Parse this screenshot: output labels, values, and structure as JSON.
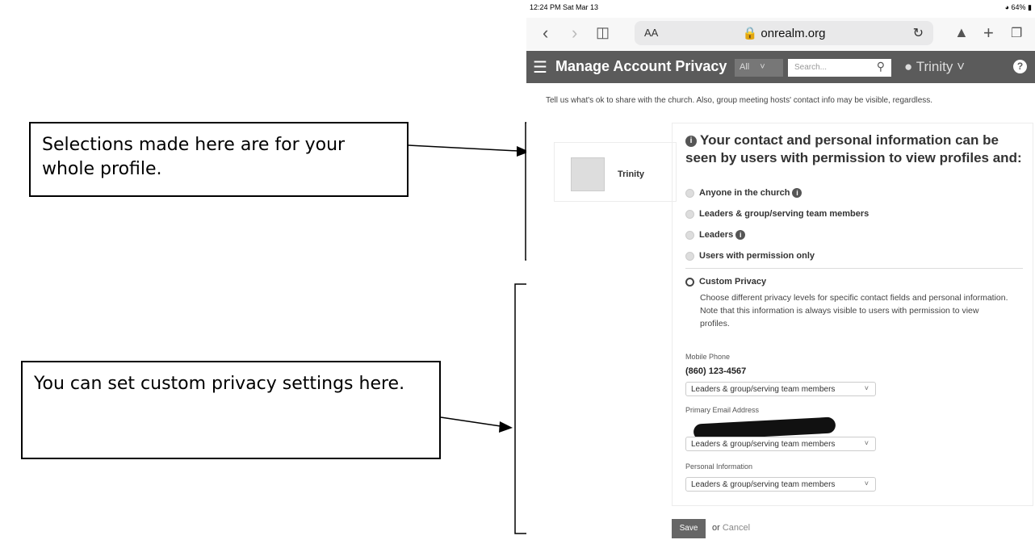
{
  "callouts": {
    "profile": "Selections made here are for your whole profile.",
    "custom": "You can set custom privacy settings here."
  },
  "status_bar": {
    "time": "12:24 PM  Sat Mar 13",
    "battery": "64%"
  },
  "browser": {
    "text_size": "AA",
    "host": "onrealm.org"
  },
  "header": {
    "title": "Manage Account Privacy",
    "filter": "All",
    "search_placeholder": "Search...",
    "user": "Trinity"
  },
  "intro": "Tell us what's ok to share with the church. Also, group meeting hosts' contact info may be visible, regardless.",
  "profile": {
    "name": "Trinity"
  },
  "privacy": {
    "heading": "Your contact and personal information can be seen by users with permission to view profiles and:",
    "options": [
      "Anyone in the church",
      "Leaders & group/serving team members",
      "Leaders",
      "Users with permission only"
    ],
    "custom_label": "Custom Privacy",
    "custom_desc": "Choose different privacy levels for specific contact fields and personal information. Note that this information is always visible to users with permission to view profiles."
  },
  "fields": {
    "mobile_label": "Mobile Phone",
    "mobile_value": "(860) 123-4567",
    "mobile_level": "Leaders & group/serving team members",
    "email_label": "Primary Email Address",
    "email_level": "Leaders & group/serving team members",
    "personal_label": "Personal Information",
    "personal_level": "Leaders & group/serving team members"
  },
  "actions": {
    "save": "Save",
    "or": "or",
    "cancel": "Cancel"
  }
}
